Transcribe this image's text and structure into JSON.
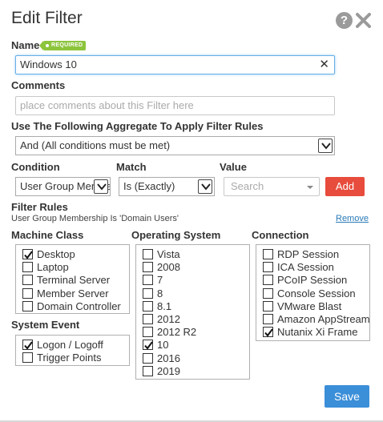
{
  "dialog": {
    "title": "Edit Filter",
    "help_icon_text": "?"
  },
  "name": {
    "label": "Name",
    "badge": "REQUIRED",
    "value": "Windows 10",
    "clear_symbol": "✕"
  },
  "comments": {
    "label": "Comments",
    "placeholder": "place comments about this Filter here"
  },
  "aggregate": {
    "label": "Use The Following Aggregate To Apply Filter Rules",
    "value": "And (All conditions must be met)"
  },
  "rule_builder": {
    "condition_label": "Condition",
    "condition_value": "User Group Membership",
    "match_label": "Match",
    "match_value": "Is (Exactly)",
    "value_label": "Value",
    "value_placeholder": "Search",
    "add_label": "Add"
  },
  "filter_rules": {
    "label": "Filter Rules",
    "rules": [
      {
        "text": "User Group Membership Is 'Domain Users'",
        "remove_label": "Remove"
      }
    ]
  },
  "machine_class": {
    "label": "Machine Class",
    "items": [
      {
        "label": "Desktop",
        "checked": true
      },
      {
        "label": "Laptop",
        "checked": false
      },
      {
        "label": "Terminal Server",
        "checked": false
      },
      {
        "label": "Member Server",
        "checked": false
      },
      {
        "label": "Domain Controller",
        "checked": false
      }
    ]
  },
  "system_event": {
    "label": "System Event",
    "items": [
      {
        "label": "Logon / Logoff",
        "checked": true
      },
      {
        "label": "Trigger Points",
        "checked": false
      }
    ]
  },
  "operating_system": {
    "label": "Operating System",
    "items": [
      {
        "label": "Vista",
        "checked": false
      },
      {
        "label": "2008",
        "checked": false
      },
      {
        "label": "7",
        "checked": false
      },
      {
        "label": "8",
        "checked": false
      },
      {
        "label": "8.1",
        "checked": false
      },
      {
        "label": "2012",
        "checked": false
      },
      {
        "label": "2012 R2",
        "checked": false
      },
      {
        "label": "10",
        "checked": true
      },
      {
        "label": "2016",
        "checked": false
      },
      {
        "label": "2019",
        "checked": false
      }
    ]
  },
  "connection": {
    "label": "Connection",
    "items": [
      {
        "label": "RDP Session",
        "checked": false
      },
      {
        "label": "ICA Session",
        "checked": false
      },
      {
        "label": "PCoIP Session",
        "checked": false
      },
      {
        "label": "Console Session",
        "checked": false
      },
      {
        "label": "VMware Blast",
        "checked": false
      },
      {
        "label": "Amazon AppStream",
        "checked": false
      },
      {
        "label": "Nutanix Xi Frame",
        "checked": true
      }
    ]
  },
  "footer": {
    "save_label": "Save"
  },
  "colors": {
    "required_badge": "#8cc43c",
    "add_button": "#e74c3c",
    "save_button": "#3b8ed8",
    "link": "#2a7ab8"
  }
}
